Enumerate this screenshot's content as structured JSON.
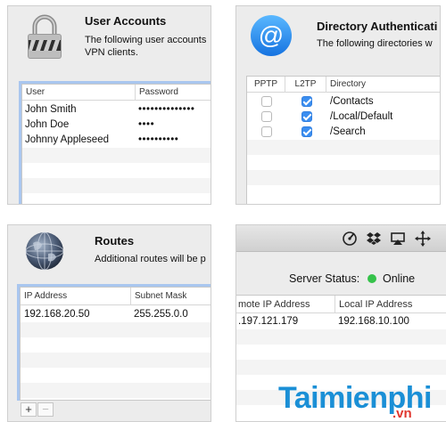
{
  "user_accounts": {
    "title": "User Accounts",
    "description_line1": "The following user accounts",
    "description_line2": "VPN clients.",
    "columns": {
      "user": "User",
      "password": "Password"
    },
    "rows": [
      {
        "user": "John Smith",
        "password": "••••••••••••••"
      },
      {
        "user": "John Doe",
        "password": "••••"
      },
      {
        "user": "Johnny Appleseed",
        "password": "••••••••••"
      }
    ]
  },
  "directory_auth": {
    "title": "Directory Authenticati",
    "description": "The following directories w",
    "columns": {
      "pptp": "PPTP",
      "l2tp": "L2TP",
      "directory": "Directory"
    },
    "rows": [
      {
        "pptp": false,
        "l2tp": true,
        "directory": "/Contacts"
      },
      {
        "pptp": false,
        "l2tp": true,
        "directory": "/Local/Default"
      },
      {
        "pptp": false,
        "l2tp": true,
        "directory": "/Search"
      }
    ]
  },
  "routes": {
    "title": "Routes",
    "description": "Additional routes will be p",
    "columns": {
      "ip": "IP Address",
      "mask": "Subnet Mask"
    },
    "rows": [
      {
        "ip": "192.168.20.50",
        "mask": "255.255.0.0"
      }
    ],
    "add_label": "+",
    "remove_label": "−"
  },
  "server_status": {
    "label": "Server Status:",
    "value": "Online",
    "status_color": "#35c24a",
    "toolbar_icons": [
      "network-utility-icon",
      "dropbox-icon",
      "airplay-icon",
      "move-icon"
    ],
    "columns": {
      "remote": "mote IP Address",
      "local": "Local IP Address"
    },
    "rows": [
      {
        "remote": ".197.121.179",
        "local": "192.168.10.100"
      }
    ]
  },
  "watermark": {
    "brand": "Taimienphi",
    "suffix": ".vn"
  }
}
